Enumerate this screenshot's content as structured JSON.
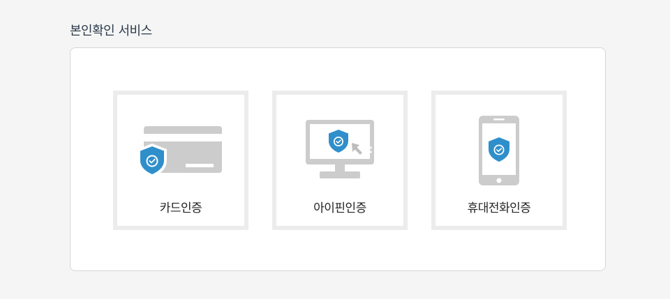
{
  "section": {
    "title": "본인확인 서비스"
  },
  "cards": [
    {
      "label": "카드인증",
      "icon": "credit-card-shield-icon"
    },
    {
      "label": "아이핀인증",
      "icon": "monitor-shield-icon"
    },
    {
      "label": "휴대전화인증",
      "icon": "phone-shield-icon"
    }
  ],
  "colors": {
    "accent": "#2f8fcb",
    "device_gray": "#cccccc",
    "card_border": "#ececec",
    "title_text": "#2b3a4a"
  }
}
